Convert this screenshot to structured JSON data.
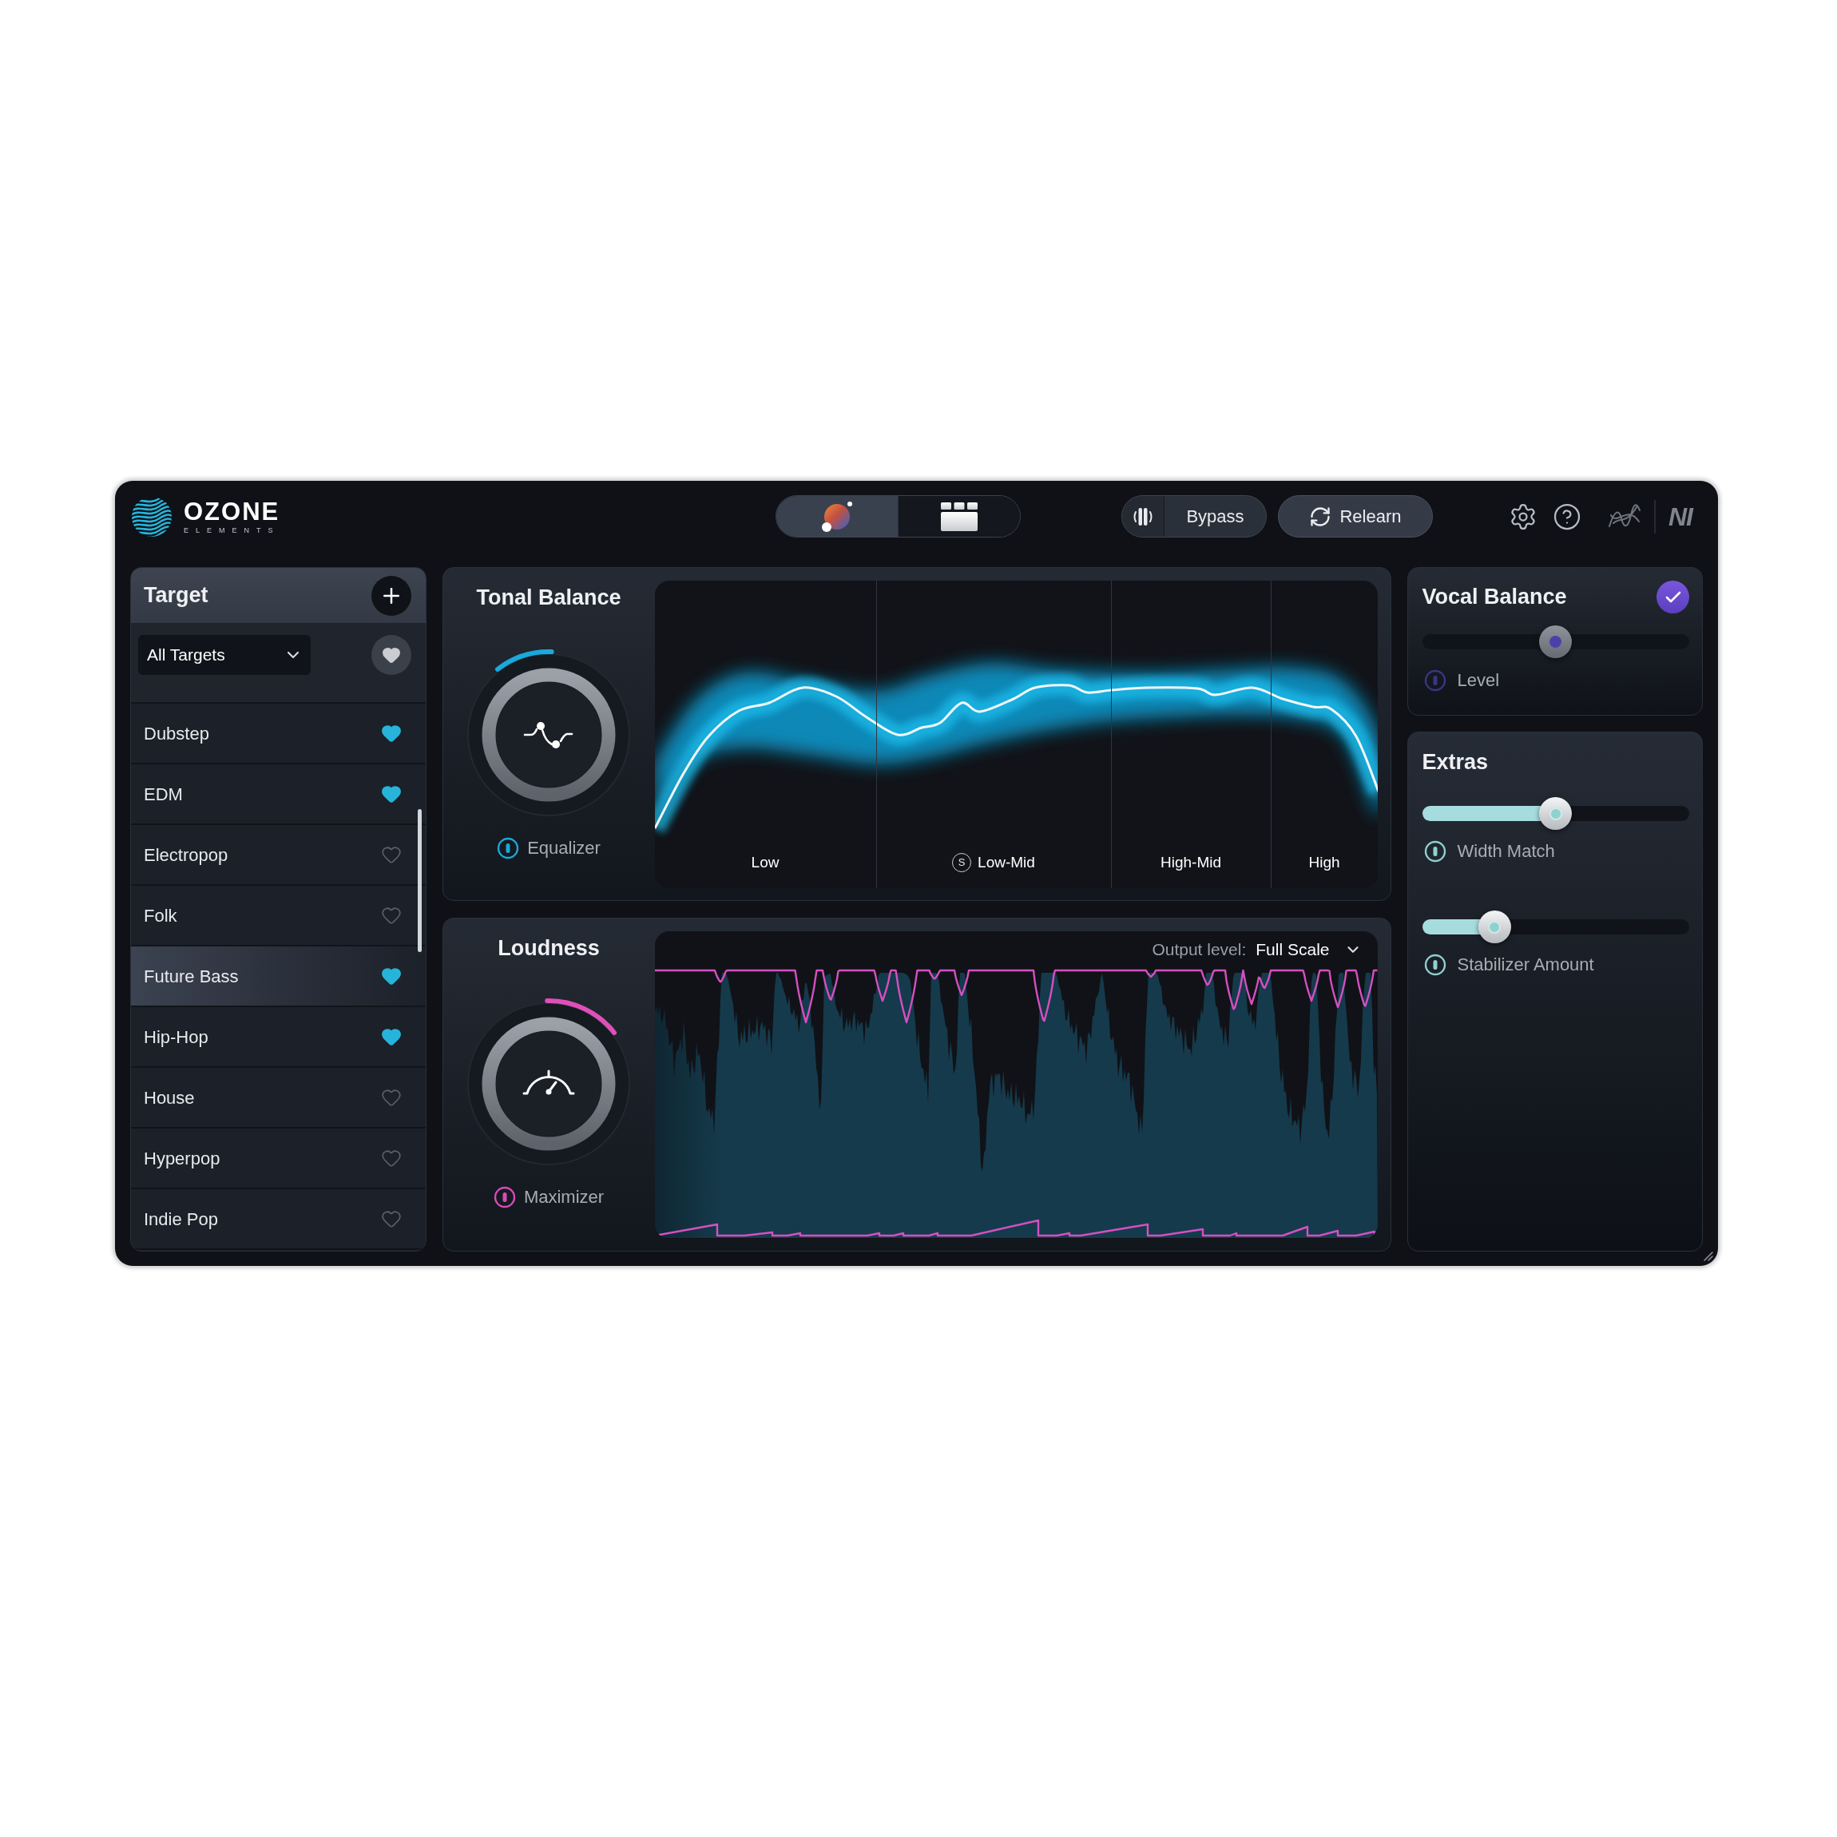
{
  "header": {
    "logo": {
      "title": "OZONE",
      "subtitle": "ELEMENTS"
    },
    "view_toggle": [
      {
        "kind": "assistant",
        "selected": true
      },
      {
        "kind": "modules",
        "selected": false
      }
    ],
    "bypass": {
      "label": "Bypass"
    },
    "relearn": {
      "label": "Relearn"
    },
    "brand_mark": "NI"
  },
  "target": {
    "title": "Target",
    "filter": {
      "value": "All Targets"
    },
    "items": [
      {
        "label": "Dubstep",
        "favorite": true,
        "selected": false
      },
      {
        "label": "EDM",
        "favorite": true,
        "selected": false
      },
      {
        "label": "Electropop",
        "favorite": false,
        "selected": false
      },
      {
        "label": "Folk",
        "favorite": false,
        "selected": false
      },
      {
        "label": "Future Bass",
        "favorite": true,
        "selected": true
      },
      {
        "label": "Hip-Hop",
        "favorite": true,
        "selected": false
      },
      {
        "label": "House",
        "favorite": false,
        "selected": false
      },
      {
        "label": "Hyperpop",
        "favorite": false,
        "selected": false
      },
      {
        "label": "Indie Pop",
        "favorite": false,
        "selected": false
      }
    ]
  },
  "tonal_balance": {
    "title": "Tonal Balance",
    "module": "Equalizer",
    "bands": [
      {
        "label": "Low"
      },
      {
        "label": "Low-Mid",
        "solo": "S"
      },
      {
        "label": "High-Mid"
      },
      {
        "label": "High"
      }
    ]
  },
  "loudness": {
    "title": "Loudness",
    "module": "Maximizer",
    "output_level": {
      "label": "Output level:",
      "value": "Full Scale"
    }
  },
  "vocal_balance": {
    "title": "Vocal Balance",
    "checked": true,
    "slider": {
      "label": "Level",
      "level": 0.5
    }
  },
  "extras": {
    "title": "Extras",
    "sliders": [
      {
        "label": "Width Match",
        "level": 0.5
      },
      {
        "label": "Stabilizer Amount",
        "level": 0.24
      }
    ]
  }
}
